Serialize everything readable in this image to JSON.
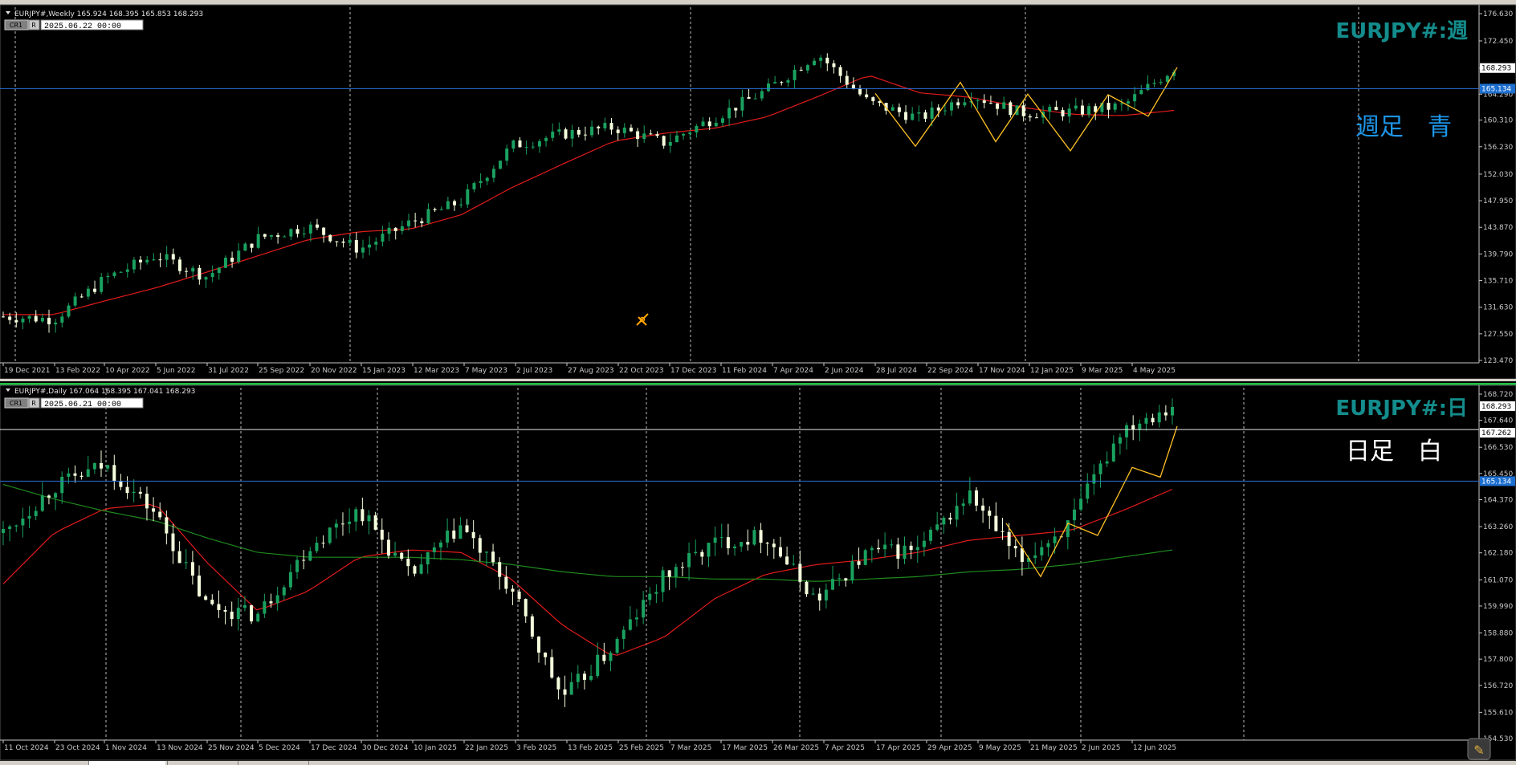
{
  "colors": {
    "background": "#000000",
    "bull": "#1aa160",
    "bear": "#f5ffdc",
    "ma_red": "#e21b1b",
    "ma_green": "#1e8a1e",
    "zigzag": "#ffc125",
    "hline_blue": "#2a6fd8",
    "hline_white": "#e8e8e8",
    "symbol_title": "#148c8c",
    "weekly_note": "#1d95e8",
    "daily_note": "#ffffff",
    "axis_text": "#c8c8c8",
    "tag_blue": "#1d6fd0"
  },
  "weekly": {
    "header": "EURJPY#,Weekly  165.924 168.395 165.853 168.293",
    "cr_label": "CR1",
    "r_label": "R",
    "time_box": "2025.06.22 00:00",
    "big_title": "EURJPY#:週",
    "note": "週足　青",
    "price_tags": [
      "168.293",
      "165.134"
    ],
    "y_ticks": [
      "176.630",
      "172.450",
      "168.293",
      "164.290",
      "160.310",
      "156.230",
      "152.030",
      "147.950",
      "143.870",
      "139.790",
      "135.710",
      "131.630",
      "127.550",
      "123.470"
    ],
    "x_ticks": [
      "19 Dec 2021",
      "13 Feb 2022",
      "10 Apr 2022",
      "5 Jun 2022",
      "31 Jul 2022",
      "25 Sep 2022",
      "20 Nov 2022",
      "15 Jan 2023",
      "12 Mar 2023",
      "7 May 2023",
      "2 Jul 2023",
      "27 Aug 2023",
      "22 Oct 2023",
      "17 Dec 2023",
      "11 Feb 2024",
      "7 Apr 2024",
      "2 Jun 2024",
      "28 Jul 2024",
      "22 Sep 2024",
      "17 Nov 2024",
      "12 Jan 2025",
      "9 Mar 2025",
      "4 May 2025"
    ],
    "hlines": {
      "blue": 165.134
    },
    "icons": [
      "pencil-cursor-icon"
    ]
  },
  "daily": {
    "header": "EURJPY#,Daily  167.064 168.395 167.041 168.293",
    "cr_label": "CR1",
    "r_label": "R",
    "time_box": "2025.06.21 00:00",
    "big_title": "EURJPY#:日",
    "note": "日足　白",
    "price_tags": [
      "168.293",
      "167.262",
      "165.134"
    ],
    "y_ticks": [
      "168.720",
      "167.640",
      "166.530",
      "165.450",
      "164.370",
      "163.260",
      "162.180",
      "161.070",
      "159.990",
      "158.880",
      "157.800",
      "156.720",
      "155.610",
      "154.530"
    ],
    "x_ticks": [
      "11 Oct 2024",
      "23 Oct 2024",
      "1 Nov 2024",
      "13 Nov 2024",
      "25 Nov 2024",
      "5 Dec 2024",
      "17 Dec 2024",
      "30 Dec 2024",
      "10 Jan 2025",
      "22 Jan 2025",
      "3 Feb 2025",
      "13 Feb 2025",
      "25 Feb 2025",
      "7 Mar 2025",
      "17 Mar 2025",
      "26 Mar 2025",
      "7 Apr 2025",
      "17 Apr 2025",
      "29 Apr 2025",
      "9 May 2025",
      "21 May 2025",
      "2 Jun 2025",
      "12 Jun 2025"
    ],
    "hlines": {
      "white": 167.262,
      "blue": 165.134
    },
    "icons": [
      "expert-advisor-icon"
    ]
  },
  "chart_data": [
    {
      "type": "candlestick",
      "panel": "weekly",
      "title": "EURJPY#:週",
      "ylim": [
        123.47,
        176.63
      ],
      "x": [
        "19 Dec 2021",
        "13 Feb 2022",
        "10 Apr 2022",
        "5 Jun 2022",
        "31 Jul 2022",
        "25 Sep 2022",
        "20 Nov 2022",
        "15 Jan 2023",
        "12 Mar 2023",
        "7 May 2023",
        "2 Jul 2023",
        "27 Aug 2023",
        "22 Oct 2023",
        "17 Dec 2023",
        "11 Feb 2024",
        "7 Apr 2024",
        "2 Jun 2024",
        "28 Jul 2024",
        "22 Sep 2024",
        "17 Nov 2024",
        "12 Jan 2025",
        "9 Mar 2025",
        "4 May 2025",
        "22 Jun 2025"
      ],
      "close": [
        130.2,
        129.8,
        136.0,
        139.6,
        136.3,
        142.2,
        144.0,
        140.5,
        144.6,
        147.9,
        156.4,
        158.2,
        159.2,
        156.8,
        160.8,
        164.9,
        170.5,
        163.0,
        160.6,
        164.2,
        161.4,
        161.6,
        162.5,
        168.293
      ],
      "ma": [
        130.5,
        130.5,
        132.6,
        134.6,
        137.0,
        139.5,
        142.0,
        143.2,
        143.6,
        145.8,
        150.0,
        153.6,
        157.1,
        158.3,
        159.1,
        160.8,
        163.9,
        167.2,
        164.5,
        163.8,
        162.3,
        161.2,
        161.0,
        161.8
      ],
      "zigzag_y": [
        164.4,
        156.3,
        166.1,
        157.0,
        164.3,
        155.6,
        164.2,
        160.9,
        168.4
      ],
      "hlines": [
        165.134
      ]
    },
    {
      "type": "candlestick",
      "panel": "daily",
      "title": "EURJPY#:日",
      "ylim": [
        154.53,
        168.72
      ],
      "x": [
        "11 Oct 2024",
        "23 Oct 2024",
        "1 Nov 2024",
        "13 Nov 2024",
        "25 Nov 2024",
        "5 Dec 2024",
        "17 Dec 2024",
        "30 Dec 2024",
        "10 Jan 2025",
        "22 Jan 2025",
        "3 Feb 2025",
        "13 Feb 2025",
        "25 Feb 2025",
        "7 Mar 2025",
        "17 Mar 2025",
        "26 Mar 2025",
        "7 Apr 2025",
        "17 Apr 2025",
        "29 Apr 2025",
        "9 May 2025",
        "21 May 2025",
        "2 Jun 2025",
        "12 Jun 2025",
        "20 Jun 2025"
      ],
      "close": [
        163.0,
        164.9,
        165.8,
        163.8,
        160.0,
        159.6,
        162.4,
        164.0,
        161.2,
        163.3,
        160.6,
        156.2,
        158.3,
        161.2,
        162.6,
        162.9,
        160.2,
        162.2,
        162.3,
        164.6,
        161.8,
        163.4,
        167.3,
        168.293
      ],
      "ma_fast": [
        160.9,
        163.0,
        164.0,
        164.2,
        161.8,
        159.8,
        160.6,
        162.0,
        162.3,
        162.2,
        161.1,
        159.2,
        157.9,
        158.7,
        160.3,
        161.3,
        161.7,
        161.9,
        162.2,
        162.7,
        162.9,
        163.1,
        163.9,
        164.8
      ],
      "ma_slow": [
        165.0,
        164.4,
        163.9,
        163.5,
        162.8,
        162.2,
        162.0,
        162.0,
        162.0,
        161.9,
        161.7,
        161.4,
        161.2,
        161.2,
        161.1,
        161.1,
        161.0,
        161.1,
        161.2,
        161.4,
        161.5,
        161.7,
        162.0,
        162.3
      ],
      "zigzag_y": [
        163.4,
        161.2,
        163.4,
        162.9,
        165.7,
        165.3,
        167.4
      ],
      "hlines": [
        167.262,
        165.134
      ]
    }
  ]
}
